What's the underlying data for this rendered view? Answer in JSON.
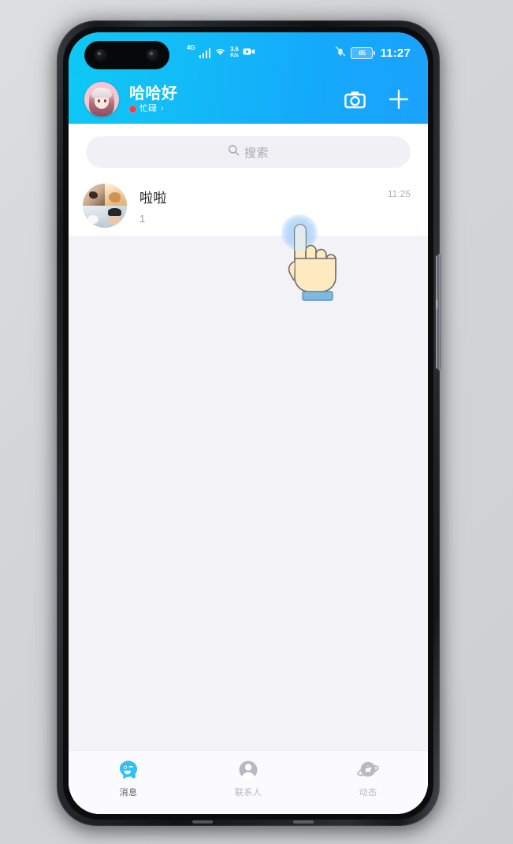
{
  "device": {
    "frame_color": "#15171a",
    "screen_bg": "#f3f2f7"
  },
  "status_bar": {
    "signal_label": "4G",
    "signal_bars": 4,
    "wifi_icon": "wifi-icon",
    "network_speed_value": "3.6",
    "network_speed_unit": "K/s",
    "screen_record_icon": "screen-record-icon",
    "mute_icon": "bell-muted-icon",
    "battery_level": "85",
    "time": "11:27",
    "accent": "#12bdf7"
  },
  "header": {
    "avatar_name": "profile-avatar",
    "nickname": "哈哈好",
    "online_status": "忙碌",
    "status_chevron": "›",
    "status_dot_color": "#f43f3f",
    "camera_icon": "camera-icon",
    "add_icon": "plus-icon",
    "gradient_from": "#0ec8f5",
    "gradient_to": "#1ba2fd"
  },
  "search": {
    "icon": "search-icon",
    "placeholder": "搜索"
  },
  "chat_list": {
    "rows": [
      {
        "avatar": "group-avatar",
        "title": "啦啦",
        "snippet": "1",
        "time": "11:25"
      }
    ]
  },
  "bottom_nav": {
    "items": [
      {
        "icon": "qq-message-icon",
        "label": "消息",
        "active": true
      },
      {
        "icon": "contacts-person-icon",
        "label": "联系人",
        "active": false
      },
      {
        "icon": "moments-planet-icon",
        "label": "动态",
        "active": false
      }
    ],
    "active_color": "#12bdf7",
    "inactive_color": "#b8b8c0"
  },
  "cursor": {
    "name": "hand-tap-cursor",
    "ripple_color": "#96c3f5"
  }
}
